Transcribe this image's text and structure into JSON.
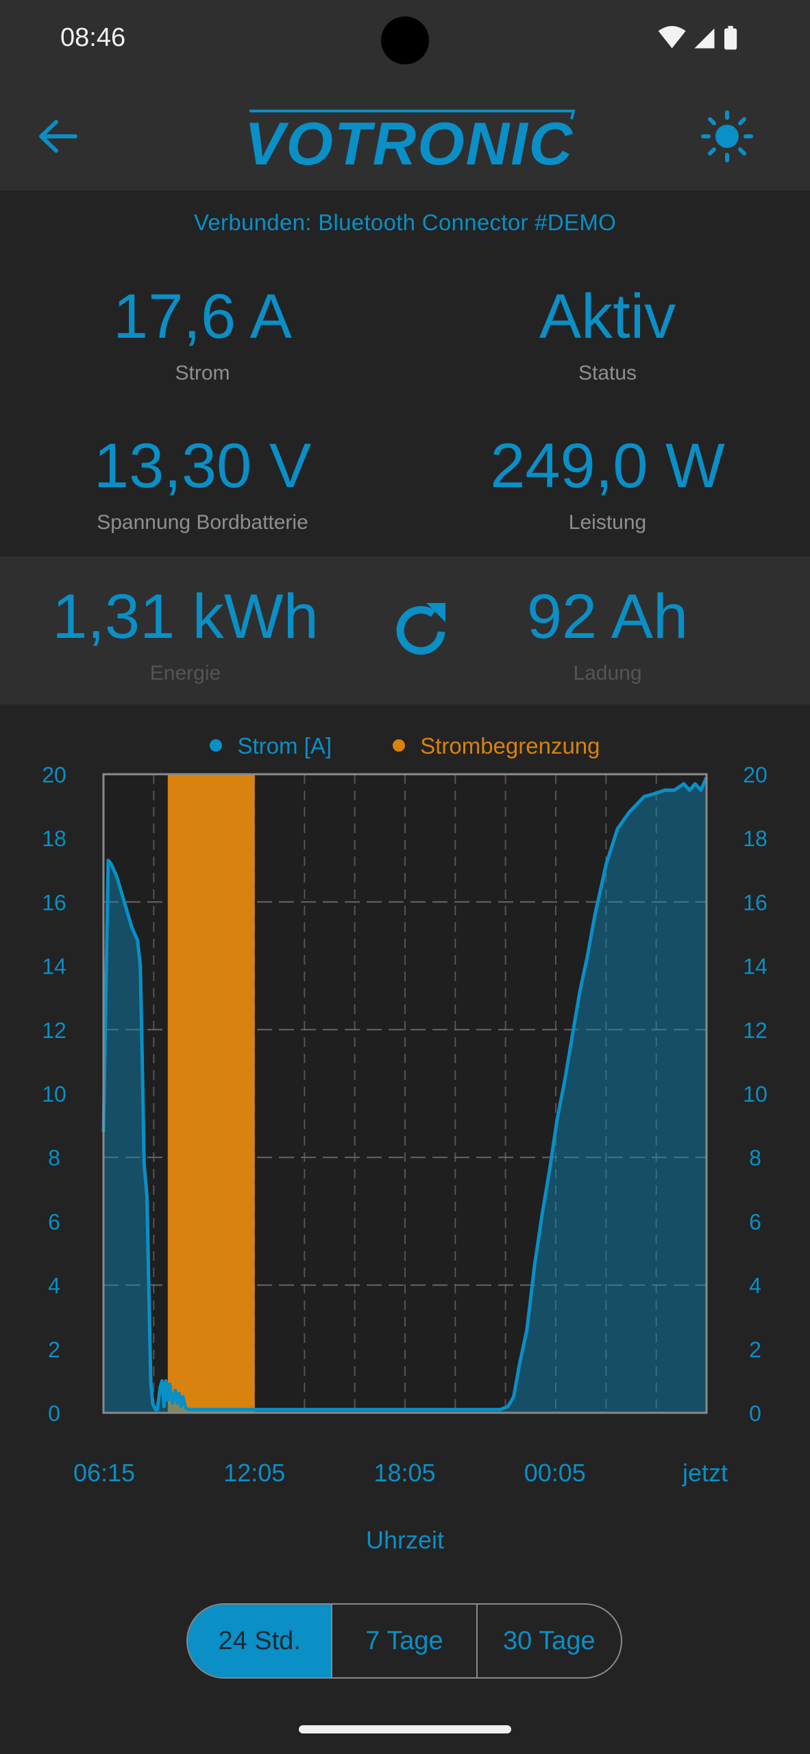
{
  "status_bar": {
    "time": "08:46"
  },
  "app_bar": {
    "logo_text": "VOTRONIC"
  },
  "connection": "Verbunden: Bluetooth Connector #DEMO",
  "metrics": {
    "current": {
      "value": "17,6 A",
      "label": "Strom"
    },
    "status": {
      "value": "Aktiv",
      "label": "Status"
    },
    "voltage": {
      "value": "13,30 V",
      "label": "Spannung Bordbatterie"
    },
    "power": {
      "value": "249,0 W",
      "label": "Leistung"
    },
    "energy": {
      "value": "1,31 kWh",
      "label": "Energie"
    },
    "charge": {
      "value": "92 Ah",
      "label": "Ladung"
    }
  },
  "colors": {
    "accent": "#0a8fc6",
    "limit": "#d8820f",
    "background": "#232323",
    "panel": "#2f2f2f"
  },
  "icons": [
    "back-arrow-icon",
    "brightness-icon",
    "refresh-icon",
    "wifi-icon",
    "signal-icon",
    "battery-icon"
  ],
  "chart_data": {
    "type": "area",
    "x_ticks": [
      "06:15",
      "12:05",
      "18:05",
      "00:05",
      "jetzt"
    ],
    "xlabel": "Uhrzeit",
    "ylim": [
      0,
      20
    ],
    "y_ticks": [
      "0",
      "2",
      "4",
      "6",
      "8",
      "10",
      "12",
      "14",
      "16",
      "18",
      "20"
    ],
    "y_ticks_right": [
      "0",
      "2",
      "4",
      "6",
      "8",
      "10",
      "12",
      "14",
      "16",
      "18",
      "20"
    ],
    "grid": true,
    "legend_position": "top-center",
    "series": [
      {
        "name": "Strom [A]",
        "color": "#0a8fc6",
        "x": [
          0.0,
          0.25,
          0.4,
          0.7,
          1.0,
          1.3,
          1.5,
          1.8,
          1.95,
          2.05,
          2.15,
          2.3,
          2.5,
          2.6,
          2.75,
          2.85,
          3.0,
          3.1,
          3.2,
          3.3,
          3.4,
          3.5,
          3.65,
          3.8,
          3.9,
          4.0,
          4.1,
          4.2,
          4.35,
          4.5,
          4.65,
          4.8,
          5.0,
          6.0,
          10.0,
          16.0,
          20.0,
          21.0,
          21.4,
          21.7,
          22.0,
          22.4,
          22.8,
          23.2,
          23.6,
          24.0,
          24.4,
          24.8,
          25.2,
          25.6,
          26.0,
          26.6,
          27.2,
          27.8,
          28.6,
          29.2,
          29.7,
          30.2,
          30.7,
          31.0,
          31.3,
          31.6,
          31.9
        ],
        "y": [
          8.8,
          17.3,
          17.2,
          16.8,
          16.2,
          15.6,
          15.2,
          14.8,
          14.0,
          11.0,
          7.8,
          6.8,
          1.0,
          0.3,
          0.1,
          0.1,
          0.8,
          1.0,
          0.2,
          1.0,
          0.4,
          0.9,
          0.3,
          0.7,
          0.3,
          0.6,
          0.2,
          0.5,
          0.15,
          0.1,
          0.1,
          0.1,
          0.1,
          0.1,
          0.1,
          0.1,
          0.1,
          0.1,
          0.2,
          0.5,
          1.5,
          2.6,
          4.6,
          6.2,
          7.6,
          9.2,
          10.4,
          11.8,
          13.2,
          14.3,
          15.6,
          17.2,
          18.3,
          18.8,
          19.3,
          19.4,
          19.5,
          19.5,
          19.7,
          19.5,
          19.7,
          19.5,
          19.9
        ]
      },
      {
        "name": "Strombegrenzung",
        "color": "#d8820f",
        "spans": [
          [
            3.4,
            8.0
          ]
        ]
      }
    ],
    "x_range": [
      0,
      31.9
    ]
  },
  "range_selector": {
    "options": [
      "24 Std.",
      "7 Tage",
      "30 Tage"
    ],
    "selected": "24 Std."
  }
}
